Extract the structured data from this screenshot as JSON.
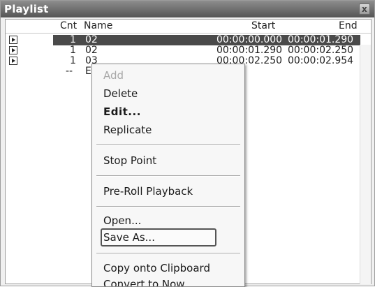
{
  "window": {
    "title": "Playlist",
    "close_label": "x"
  },
  "columns": {
    "cnt": "Cnt",
    "name": "Name",
    "start": "Start",
    "end": "End"
  },
  "rows": [
    {
      "cnt": "1",
      "name": "02",
      "start": "00:00:00.000",
      "end": "00:00:01.290",
      "selected": true
    },
    {
      "cnt": "1",
      "name": "02",
      "start": "00:00:01.290",
      "end": "00:00:02.250",
      "selected": false
    },
    {
      "cnt": "1",
      "name": "03",
      "start": "00:00:02.250",
      "end": "00:00:02.954",
      "selected": false
    },
    {
      "cnt": "--",
      "name": "E",
      "start": "",
      "end": "",
      "selected": false
    }
  ],
  "menu": {
    "add": "Add",
    "delete": "Delete",
    "edit": "Edit...",
    "replicate": "Replicate",
    "stop_point": "Stop Point",
    "pre_roll": "Pre-Roll Playback",
    "open": "Open...",
    "save_as": "Save As...",
    "copy": "Copy onto Clipboard",
    "convert": "Convert to Now"
  },
  "icons": {
    "row_play": "play-icon",
    "close": "close-icon"
  }
}
